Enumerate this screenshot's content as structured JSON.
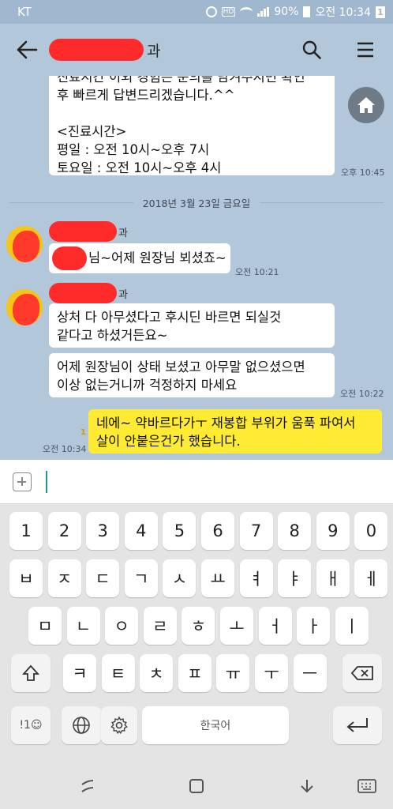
{
  "status_bar": {
    "carrier": "KT",
    "battery": "90%",
    "time": "오전 10:34",
    "notification_count": "1",
    "hd_label": "HD"
  },
  "header": {
    "title_suffix": "과"
  },
  "chat": {
    "messages": [
      {
        "text": "진료시간 이외 경험은 문의를 남겨주시면 확인\n후 빠르게 답변드리겠습니다.^^\n\n<진료시간>\n평일 : 오전 10시~오후 7시\n토요일 : 오전 10시~오후 4시",
        "time": "오후 10:45"
      },
      {
        "sender_suffix": "과",
        "text": "님~어제 원장님 뵈셨죠~",
        "time": "오전 10:21"
      },
      {
        "sender_suffix": "과",
        "text": "상처 다 아무셨다고 후시딘 바르면 되실것\n같다고 하셨거든요~"
      },
      {
        "text": "어제 원장님이 상태 보셨고 아무말 없으셨으면\n이상 없는거니까 걱정하지 마세요",
        "time": "오전 10:22"
      },
      {
        "text": "네에~ 약바르다가ㅜ 재봉합 부위가 움푹 파여서\n살이 안붙은건가 했습니다.",
        "time": "오전 10:34",
        "read_count": "1"
      }
    ],
    "date_separator": "2018년 3월 23일 금요일"
  },
  "input": {
    "value": "",
    "placeholder": ""
  },
  "keyboard": {
    "row_numbers": [
      "1",
      "2",
      "3",
      "4",
      "5",
      "6",
      "7",
      "8",
      "9",
      "0"
    ],
    "row1": [
      "ㅂ",
      "ㅈ",
      "ㄷ",
      "ㄱ",
      "ㅅ",
      "ㅛ",
      "ㅕ",
      "ㅑ",
      "ㅐ",
      "ㅔ"
    ],
    "row2": [
      "ㅁ",
      "ㄴ",
      "ㅇ",
      "ㄹ",
      "ㅎ",
      "ㅗ",
      "ㅓ",
      "ㅏ",
      "ㅣ"
    ],
    "row3": [
      "ㅋ",
      "ㅌ",
      "ㅊ",
      "ㅍ",
      "ㅠ",
      "ㅜ",
      "ㅡ"
    ],
    "symbols_key": "!1☺",
    "space_label": "한국어"
  },
  "colors": {
    "chat_background": "#b2c7da",
    "my_bubble": "#ffeb33",
    "other_bubble": "#ffffff",
    "caret": "#1a9c8c"
  }
}
